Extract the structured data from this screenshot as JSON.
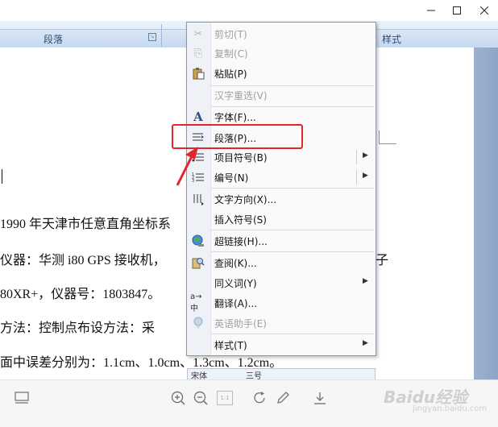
{
  "window": {
    "minimize_icon": "minimize-icon",
    "maximize_icon": "maximize-icon",
    "close_icon": "close-icon"
  },
  "ribbon": {
    "paragraph_label": "段落",
    "style_label": "样式"
  },
  "document": {
    "lines": [
      "1990 年天津市任意直角坐标系",
      "仪器：华测 i80 GPS 接收机，",
      "80XR+，仪器号：1803847。",
      "方法：控制点布设方法：采",
      "面中误差分别为：1.1cm、1.0cm、1.3cm、1.2cm。"
    ],
    "line2_tail": "子"
  },
  "mini_toolbar": {
    "font_label": "宋体",
    "size_label": "三号"
  },
  "context_menu": {
    "items": [
      {
        "label": "剪切(T)",
        "icon": "scissors-icon",
        "enabled": false
      },
      {
        "label": "复制(C)",
        "icon": "copy-icon",
        "enabled": false
      },
      {
        "label": "粘贴(P)",
        "icon": "paste-icon",
        "enabled": true
      },
      {
        "label": "汉字重选(V)",
        "icon": "",
        "enabled": false
      },
      {
        "label": "字体(F)...",
        "icon": "font-icon",
        "enabled": true
      },
      {
        "label": "段落(P)...",
        "icon": "paragraph-icon",
        "enabled": true,
        "highlighted": true
      },
      {
        "label": "项目符号(B)",
        "icon": "bullets-icon",
        "enabled": true,
        "submenu": true
      },
      {
        "label": "编号(N)",
        "icon": "numbering-icon",
        "enabled": true,
        "submenu": true
      },
      {
        "label": "文字方向(X)...",
        "icon": "text-direction-icon",
        "enabled": true
      },
      {
        "label": "插入符号(S)",
        "icon": "",
        "enabled": true
      },
      {
        "label": "超链接(H)...",
        "icon": "hyperlink-icon",
        "enabled": true
      },
      {
        "label": "查阅(K)...",
        "icon": "lookup-icon",
        "enabled": true
      },
      {
        "label": "同义词(Y)",
        "icon": "",
        "enabled": true,
        "submenu": true
      },
      {
        "label": "翻译(A)...",
        "icon": "translate-icon",
        "enabled": true
      },
      {
        "label": "英语助手(E)",
        "icon": "english-assistant-icon",
        "enabled": false
      },
      {
        "label": "样式(T)",
        "icon": "",
        "enabled": true,
        "submenu": true
      }
    ]
  },
  "bottom_toolbar": {
    "icons": [
      "panel-icon",
      "zoom-in-icon",
      "zoom-out-icon",
      "page-fit-icon",
      "rotate-icon",
      "edit-icon",
      "download-icon"
    ],
    "page_fit_text": "1:1"
  },
  "watermark": {
    "text": "Baidu经验",
    "sub": "jingyan.baidu.com"
  },
  "colors": {
    "highlight": "#e3262c",
    "ribbon": "#d6e4f5",
    "menu_bg": "#fafafa"
  }
}
